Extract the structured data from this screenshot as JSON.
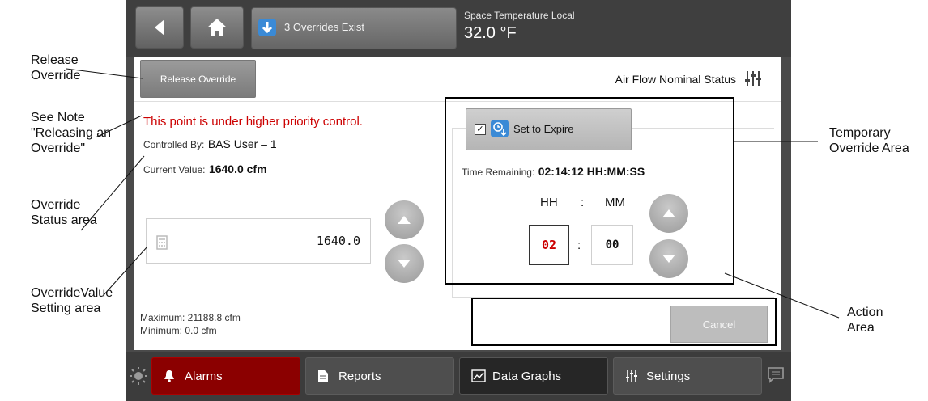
{
  "topbar": {
    "overrides_label": "3 Overrides Exist",
    "point_name": "Space Temperature Local",
    "point_value": "32.0 °F"
  },
  "panel": {
    "release_button": "Release Override",
    "airflow_status": "Air Flow Nominal Status",
    "warning": "This point is under higher priority control.",
    "controlled_by_label": "Controlled By:",
    "controlled_by_value": "BAS User – 1",
    "current_value_label": "Current Value:",
    "current_value": "1640.0 cfm",
    "override_value": "1640.0",
    "maximum": "Maximum: 21188.8 cfm",
    "minimum": "Minimum: 0.0 cfm"
  },
  "expire": {
    "label": "Set to Expire",
    "checked_mark": "☑",
    "time_remaining_label": "Time Remaining:",
    "time_remaining_value": "02:14:12 HH:MM:SS",
    "hh_header": "HH",
    "mm_header": "MM",
    "colon": ":",
    "hh_value": "02",
    "mm_value": "00"
  },
  "actions": {
    "cancel": "Cancel"
  },
  "bottombar": {
    "alarms": "Alarms",
    "reports": "Reports",
    "data_graphs": "Data Graphs",
    "settings": "Settings"
  },
  "callouts": {
    "release_override": "Release\nOverride",
    "see_note": "See Note\n\"Releasing an\nOverride\"",
    "override_status": "Override\nStatus area",
    "override_value": "OverrideValue\nSetting area",
    "temporary_override": "Temporary\nOverride Area",
    "action_area": "Action\nArea"
  },
  "colors": {
    "warning_red": "#cc0000",
    "alarms_red": "#8b0000",
    "accent_blue": "#3a8ad6"
  }
}
